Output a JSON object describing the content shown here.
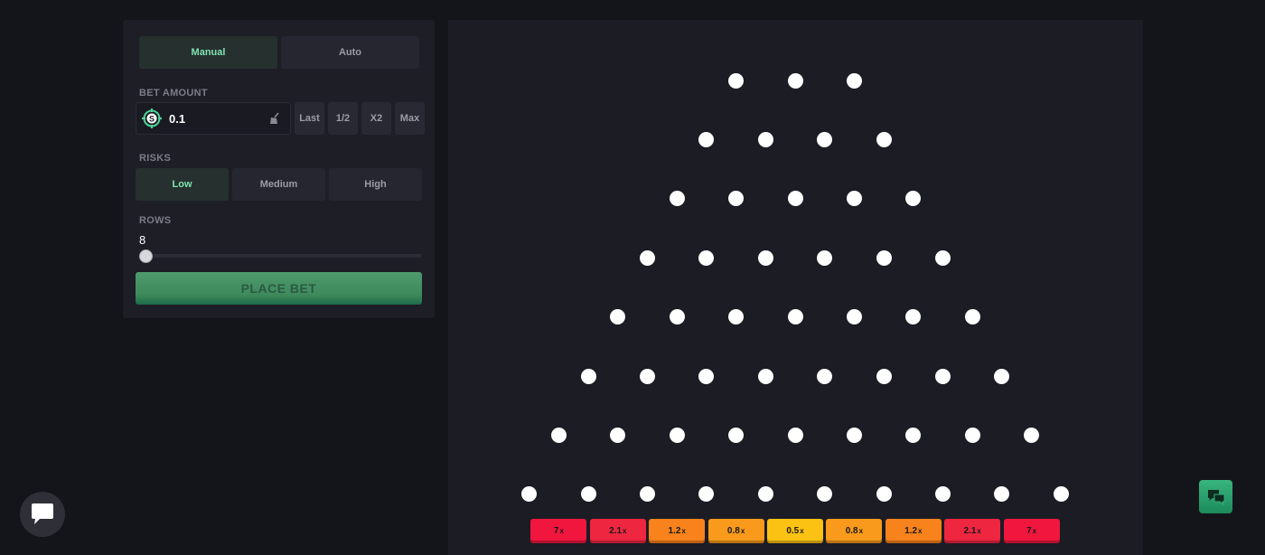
{
  "mode_tabs": [
    {
      "label": "Manual",
      "active": true
    },
    {
      "label": "Auto",
      "active": false
    }
  ],
  "bet": {
    "label": "BET AMOUNT",
    "value": "0.1",
    "buttons": [
      "Last",
      "1/2",
      "X2",
      "Max"
    ]
  },
  "risk": {
    "label": "RISKS",
    "options": [
      {
        "label": "Low",
        "active": true
      },
      {
        "label": "Medium",
        "active": false
      },
      {
        "label": "High",
        "active": false
      }
    ]
  },
  "rows": {
    "label": "ROWS",
    "value": "8",
    "slider_min": 8,
    "slider_max": 16,
    "slider_value": 8
  },
  "place_bet_label": "PLACE BET",
  "board": {
    "peg_rows": [
      3,
      4,
      5,
      6,
      7,
      8,
      9,
      10
    ],
    "multipliers": [
      {
        "value": "7",
        "suffix": "x",
        "color": "#f0163e"
      },
      {
        "value": "2.1",
        "suffix": "x",
        "color": "#ee2640"
      },
      {
        "value": "1.2",
        "suffix": "x",
        "color": "#f8821b"
      },
      {
        "value": "0.8",
        "suffix": "x",
        "color": "#f99a1c"
      },
      {
        "value": "0.5",
        "suffix": "x",
        "color": "#fbc213"
      },
      {
        "value": "0.8",
        "suffix": "x",
        "color": "#f99a1c"
      },
      {
        "value": "1.2",
        "suffix": "x",
        "color": "#f8821b"
      },
      {
        "value": "2.1",
        "suffix": "x",
        "color": "#ee2640"
      },
      {
        "value": "7",
        "suffix": "x",
        "color": "#f0163e"
      }
    ]
  },
  "icons": {
    "coin": "coin-icon",
    "clear": "broom-icon",
    "chat": "chat-bubble-icon",
    "support": "support-chat-icon"
  },
  "colors": {
    "accent": "#7fe3b4",
    "place_bet": "#3f8a5d",
    "peg": "#ffffff"
  }
}
